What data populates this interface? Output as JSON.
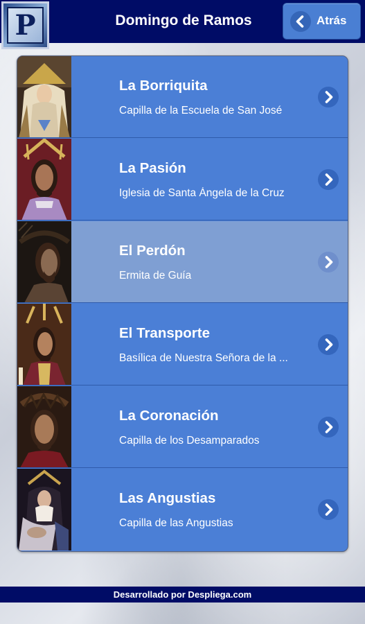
{
  "header": {
    "title": "Domingo de Ramos",
    "back_label": "Atrás",
    "logo_letter": "P"
  },
  "list": {
    "items": [
      {
        "title": "La Borriquita",
        "subtitle": "Capilla de la Escuela de San José",
        "thumbnail": "virgin-image",
        "selected": false
      },
      {
        "title": "La Pasión",
        "subtitle": "Iglesia de Santa Ángela de la Cruz",
        "thumbnail": "christ-image",
        "selected": false
      },
      {
        "title": "El Perdón",
        "subtitle": "Ermita de Guía",
        "thumbnail": "christ-image",
        "selected": true
      },
      {
        "title": "El Transporte",
        "subtitle": "Basílica de Nuestra Señora de la ...",
        "thumbnail": "christ-image",
        "selected": false
      },
      {
        "title": "La Coronación",
        "subtitle": "Capilla de los Desamparados",
        "thumbnail": "christ-image",
        "selected": false
      },
      {
        "title": "Las Angustias",
        "subtitle": "Capilla de las Angustias",
        "thumbnail": "virgin-image",
        "selected": false
      }
    ]
  },
  "footer": {
    "text": "Desarrollado por Despliega.com"
  },
  "colors": {
    "header_bg": "#000c66",
    "item_bg": "#4b7fd6",
    "item_selected_bg": "#7f9fd3",
    "button_bg": "#4a7fd3",
    "chevron_bg": "#3466bd"
  },
  "icons": {
    "back": "chevron-left-icon",
    "item_chevron": "chevron-right-icon"
  }
}
